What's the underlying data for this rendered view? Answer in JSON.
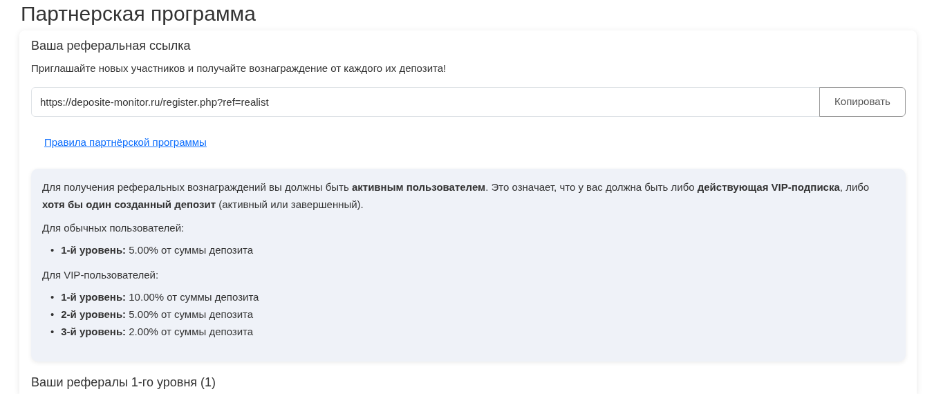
{
  "page_title": "Партнерская программа",
  "referral": {
    "heading": "Ваша реферальная ссылка",
    "description": "Приглашайте новых участников и получайте вознаграждение от каждого их депозита!",
    "link_value": "https://deposite-monitor.ru/register.php?ref=realist",
    "copy_button": "Копировать",
    "rules_link": "Правила партнёрской программы"
  },
  "info": {
    "intro": "Для получения реферальных вознаграждений вы должны быть **активным пользователем**. Это означает, что у вас должна быть либо **действующая VIP-подписка**, либо **хотя бы один созданный депозит** (активный или завершенный).",
    "groups": [
      {
        "title": "Для обычных пользователей:",
        "items": [
          {
            "marker": "•",
            "text": "**1-й уровень:** 5.00% от суммы депозита"
          }
        ]
      },
      {
        "title": "Для VIP-пользователей:",
        "items": [
          {
            "marker": "•",
            "text": "**1-й уровень:** 10.00% от суммы депозита"
          },
          {
            "marker": "•",
            "text": "**2-й уровень:** 5.00% от суммы депозита"
          },
          {
            "marker": "•",
            "text": "**3-й уровень:** 2.00% от суммы депозита"
          }
        ]
      }
    ]
  },
  "referrals_heading": "Ваши рефералы 1-го уровня (1)"
}
